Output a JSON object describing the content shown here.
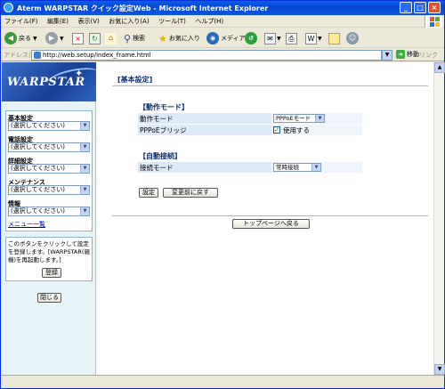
{
  "window": {
    "title": "Aterm WARPSTAR クイック設定Web - Microsoft Internet Explorer"
  },
  "menu": [
    "ファイル(F)",
    "編集(E)",
    "表示(V)",
    "お気に入り(A)",
    "ツール(T)",
    "ヘルプ(H)"
  ],
  "toolbar": {
    "back": "戻る",
    "search": "検索",
    "favorites": "お気に入り",
    "media": "メディア"
  },
  "address": {
    "label": "アドレス(D)",
    "url": "http://web.setup/index_frame.html",
    "go": "移動",
    "links": "リンク"
  },
  "sidebar": {
    "logo": "WARPSTAR",
    "groups": [
      {
        "heading": "基本設定",
        "value": "(選択してください)"
      },
      {
        "heading": "電話設定",
        "value": "(選択してください)"
      },
      {
        "heading": "詳細設定",
        "value": "(選択してください)"
      },
      {
        "heading": "メンテナンス",
        "value": "(選択してください)"
      },
      {
        "heading": "情報",
        "value": "(選択してください)"
      }
    ],
    "menu_list": "メニュー一覧",
    "register_note": "このボタンをクリックして設定を登録します。[WARPSTAR(親機)を再起動します。]",
    "register_button": "登録",
    "close_button": "閉じる"
  },
  "main": {
    "title": "[基本設定]",
    "section1": {
      "heading": "【動作モード】",
      "rows": [
        {
          "label": "動作モード",
          "value": "PPPoEモード"
        },
        {
          "label": "PPPoEブリッジ",
          "checkbox_label": "使用する",
          "checked": true
        }
      ]
    },
    "section2": {
      "heading": "【自動接続】",
      "rows": [
        {
          "label": "接続モード",
          "value": "常時接続"
        }
      ]
    },
    "set_button": "設定",
    "revert_button": "変更前に戻す",
    "top_button": "トップページへ戻る"
  }
}
